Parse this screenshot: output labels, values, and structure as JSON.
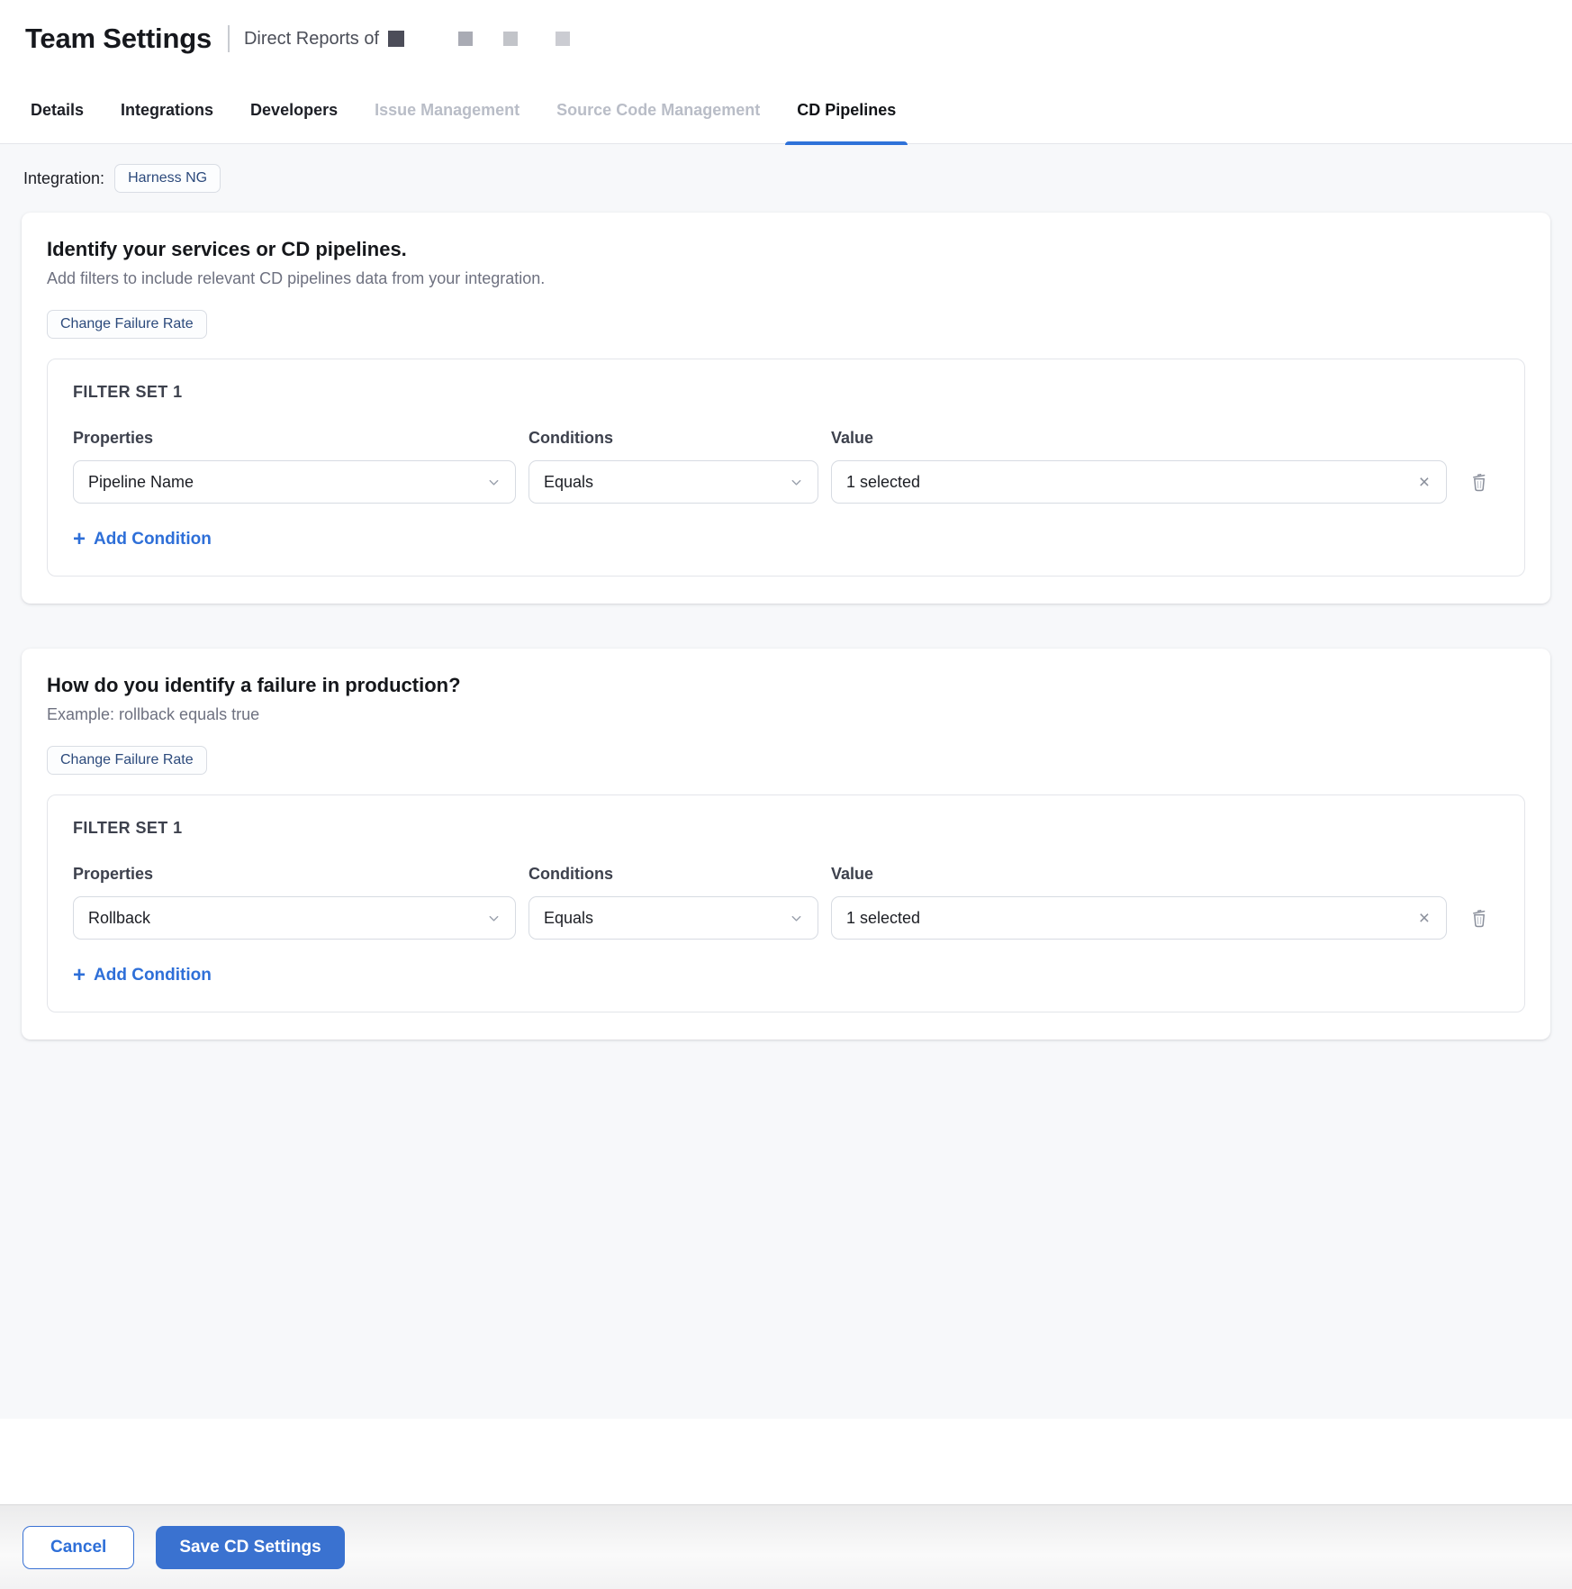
{
  "header": {
    "title": "Team Settings",
    "subtitle": "Direct Reports of",
    "redacted_blocks": [
      "#4c4d59",
      "#a9abb4",
      "#c2c4c9",
      "#cbccd2"
    ]
  },
  "tabs": [
    {
      "label": "Details",
      "state": "enabled"
    },
    {
      "label": "Integrations",
      "state": "enabled"
    },
    {
      "label": "Developers",
      "state": "enabled"
    },
    {
      "label": "Issue Management",
      "state": "disabled"
    },
    {
      "label": "Source Code Management",
      "state": "disabled"
    },
    {
      "label": "CD Pipelines",
      "state": "active"
    }
  ],
  "integration": {
    "label": "Integration:",
    "chip": "Harness NG"
  },
  "cards": [
    {
      "title": "Identify your services or CD pipelines.",
      "subtitle": "Add filters to include relevant CD pipelines data from your integration.",
      "metric_chip": "Change Failure Rate",
      "filter_set": {
        "title": "FILTER SET 1",
        "columns": {
          "properties": "Properties",
          "conditions": "Conditions",
          "value": "Value"
        },
        "property": "Pipeline Name",
        "condition": "Equals",
        "value": "1 selected",
        "add_condition": "Add Condition"
      }
    },
    {
      "title": "How do you identify a failure in production?",
      "subtitle": "Example: rollback equals true",
      "metric_chip": "Change Failure Rate",
      "filter_set": {
        "title": "FILTER SET 1",
        "columns": {
          "properties": "Properties",
          "conditions": "Conditions",
          "value": "Value"
        },
        "property": "Rollback",
        "condition": "Equals",
        "value": "1 selected",
        "add_condition": "Add Condition"
      }
    }
  ],
  "footer": {
    "cancel": "Cancel",
    "save": "Save CD Settings"
  },
  "icons": {
    "plus": "+",
    "close": "×"
  },
  "colors": {
    "accent_blue": "#2f72d9",
    "save_button": "#3a72d0",
    "chip_text": "#2c4a7c",
    "content_background": "#f7f8fa",
    "disabled_tab": "#b9bdc7",
    "muted_text": "#6e7180"
  }
}
